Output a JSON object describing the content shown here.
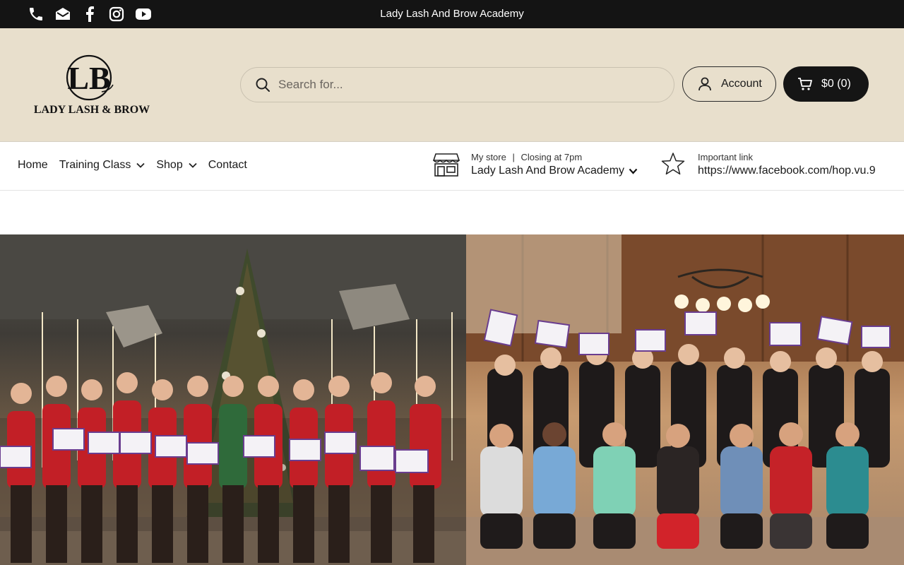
{
  "topbar": {
    "announcement": "Lady Lash And Brow Academy",
    "social_icons": [
      "phone-icon",
      "email-icon",
      "facebook-icon",
      "instagram-icon",
      "youtube-icon"
    ]
  },
  "header": {
    "logo": {
      "monogram": "LB",
      "text": "LADY LASH & BROW"
    },
    "search": {
      "placeholder": "Search for..."
    },
    "account_label": "Account",
    "cart_label": "$0 (0)"
  },
  "nav": {
    "items": [
      {
        "label": "Home",
        "has_dropdown": false
      },
      {
        "label": "Training Class",
        "has_dropdown": true
      },
      {
        "label": "Shop",
        "has_dropdown": true
      },
      {
        "label": "Contact",
        "has_dropdown": false
      }
    ]
  },
  "store": {
    "label": "My store",
    "separator": "|",
    "hours": "Closing at 7pm",
    "name": "Lady Lash And Brow Academy"
  },
  "important": {
    "label": "Important link",
    "url": "https://www.facebook.com/hop.vu.9"
  },
  "colors": {
    "topbar_bg": "#141414",
    "header_bg": "#e8dfcc",
    "cart_bg": "#151515"
  }
}
